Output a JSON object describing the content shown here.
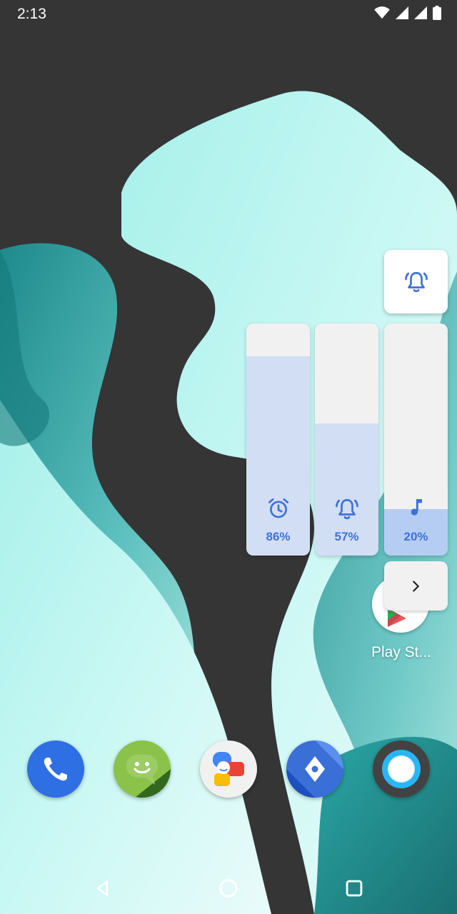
{
  "status_bar": {
    "time": "2:13",
    "icons": [
      "wifi-icon",
      "signal-icon",
      "signal-icon",
      "battery-icon"
    ]
  },
  "volume_panel": {
    "ringer_toggle_icon": "bell-ringing-icon",
    "sliders": [
      {
        "name": "alarm",
        "icon": "alarm-clock-icon",
        "level": 0.86,
        "label": "86%"
      },
      {
        "name": "ring",
        "icon": "bell-ringing-icon",
        "level": 0.57,
        "label": "57%"
      },
      {
        "name": "media",
        "icon": "music-note-icon",
        "level": 0.2,
        "label": "20%"
      }
    ],
    "expand_icon": "chevron-right-icon"
  },
  "home_apps": [
    {
      "label": "Play St...",
      "icon": "play-store-icon"
    }
  ],
  "dock": [
    "phone-icon",
    "messaging-icon",
    "chat-apps-icon",
    "maps-nav-icon",
    "camera-icon"
  ],
  "nav_bar": [
    "back-icon",
    "home-icon",
    "recents-icon"
  ],
  "colors": {
    "accent": "#3d72d6",
    "slider_track": "#f1f1f1",
    "slider_fill": "#d2def4",
    "slider_fill_active": "#b6cdf3"
  }
}
